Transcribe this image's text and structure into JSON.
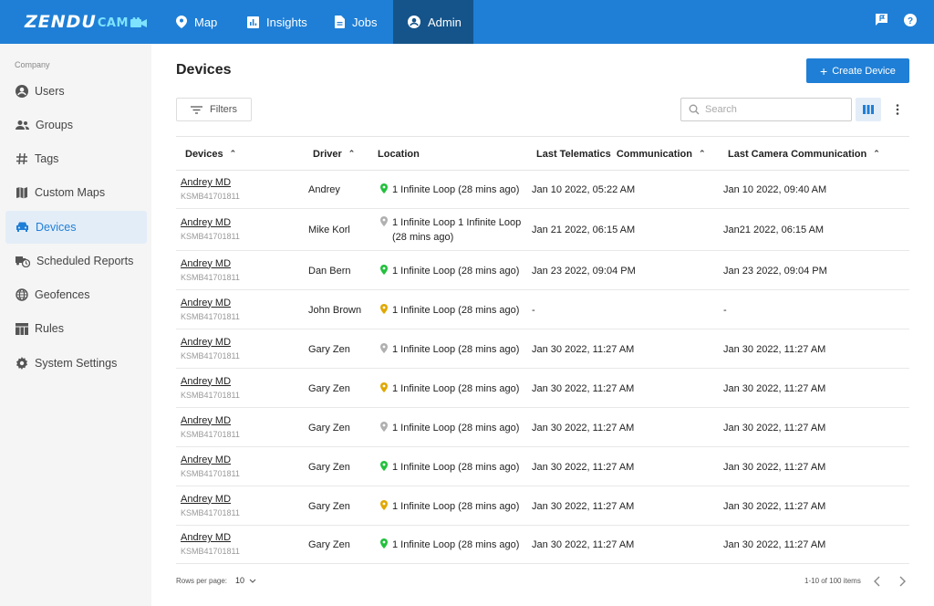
{
  "header": {
    "logo_main": "ZENDU",
    "logo_sub": "CAM",
    "nav": [
      {
        "label": "Map",
        "icon": "map-pin-icon"
      },
      {
        "label": "Insights",
        "icon": "chart-icon"
      },
      {
        "label": "Jobs",
        "icon": "document-icon"
      },
      {
        "label": "Admin",
        "icon": "account-icon"
      }
    ],
    "active_nav": "Admin",
    "colors": {
      "bar": "#1f7fd6",
      "active": "#15548a"
    }
  },
  "sidebar": {
    "section": "Company",
    "items": [
      {
        "label": "Users",
        "icon": "user-circle-icon"
      },
      {
        "label": "Groups",
        "icon": "people-icon"
      },
      {
        "label": "Tags",
        "icon": "hash-icon"
      },
      {
        "label": "Custom Maps",
        "icon": "map-icon"
      },
      {
        "label": "Devices",
        "icon": "car-icon"
      },
      {
        "label": "Scheduled Reports",
        "icon": "truck-clock-icon"
      },
      {
        "label": "Geofences",
        "icon": "globe-icon"
      },
      {
        "label": "Rules",
        "icon": "table-icon"
      },
      {
        "label": "System Settings",
        "icon": "gear-icon"
      }
    ],
    "active": "Devices"
  },
  "main": {
    "title": "Devices",
    "create_label": "Create Device",
    "filters_label": "Filters",
    "search_placeholder": "Search",
    "columns": [
      "Devices",
      "Driver",
      "Location",
      "Last Telematics  Communication",
      "Last Camera Communication"
    ],
    "rows": [
      {
        "device": "Andrey MD",
        "id": "KSMB41701811",
        "driver": "Andrey",
        "location": "1 Infinite Loop (28 mins ago)",
        "pin": "green",
        "telematics": "Jan 10 2022, 05:22 AM",
        "camera": "Jan 10 2022, 09:40 AM"
      },
      {
        "device": "Andrey MD",
        "id": "KSMB41701811",
        "driver": "Mike Korl",
        "location": "1 Infinite Loop 1 Infinite Loop (28 mins ago)",
        "pin": "gray",
        "telematics": "Jan 21 2022, 06:15 AM",
        "camera": "Jan21 2022, 06:15 AM"
      },
      {
        "device": "Andrey MD",
        "id": "KSMB41701811",
        "driver": "Dan Bern",
        "location": "1 Infinite Loop (28 mins ago)",
        "pin": "green",
        "telematics": "Jan 23 2022, 09:04 PM",
        "camera": "Jan 23 2022, 09:04 PM"
      },
      {
        "device": "Andrey MD",
        "id": "KSMB41701811",
        "driver": "John Brown",
        "location": "1 Infinite Loop (28 mins ago)",
        "pin": "yellow",
        "telematics": "-",
        "camera": "-"
      },
      {
        "device": "Andrey MD",
        "id": "KSMB41701811",
        "driver": "Gary Zen",
        "location": "1 Infinite Loop (28 mins ago)",
        "pin": "gray",
        "telematics": "Jan 30 2022, 11:27 AM",
        "camera": "Jan 30 2022, 11:27 AM"
      },
      {
        "device": "Andrey MD",
        "id": "KSMB41701811",
        "driver": "Gary Zen",
        "location": "1 Infinite Loop (28 mins ago)",
        "pin": "yellow",
        "telematics": "Jan 30 2022, 11:27 AM",
        "camera": "Jan 30 2022, 11:27 AM"
      },
      {
        "device": "Andrey MD",
        "id": "KSMB41701811",
        "driver": "Gary Zen",
        "location": "1 Infinite Loop (28 mins ago)",
        "pin": "gray",
        "telematics": "Jan 30 2022, 11:27 AM",
        "camera": "Jan 30 2022, 11:27 AM"
      },
      {
        "device": "Andrey MD",
        "id": "KSMB41701811",
        "driver": "Gary Zen",
        "location": "1 Infinite Loop (28 mins ago)",
        "pin": "green",
        "telematics": "Jan 30 2022, 11:27 AM",
        "camera": "Jan 30 2022, 11:27 AM"
      },
      {
        "device": "Andrey MD",
        "id": "KSMB41701811",
        "driver": "Gary Zen",
        "location": "1 Infinite Loop (28 mins ago)",
        "pin": "yellow",
        "telematics": "Jan 30 2022, 11:27 AM",
        "camera": "Jan 30 2022, 11:27 AM"
      },
      {
        "device": "Andrey MD",
        "id": "KSMB41701811",
        "driver": "Gary Zen",
        "location": "1 Infinite Loop (28 mins ago)",
        "pin": "green",
        "telematics": "Jan 30 2022, 11:27 AM",
        "camera": "Jan 30 2022, 11:27 AM"
      }
    ],
    "pin_colors": {
      "green": "#22c03c",
      "yellow": "#e0a800",
      "gray": "#b0b0b0"
    }
  },
  "footer": {
    "rows_per_page_label": "Rows per page:",
    "rows_per_page": "10",
    "range": "1-10 of 100 items"
  }
}
